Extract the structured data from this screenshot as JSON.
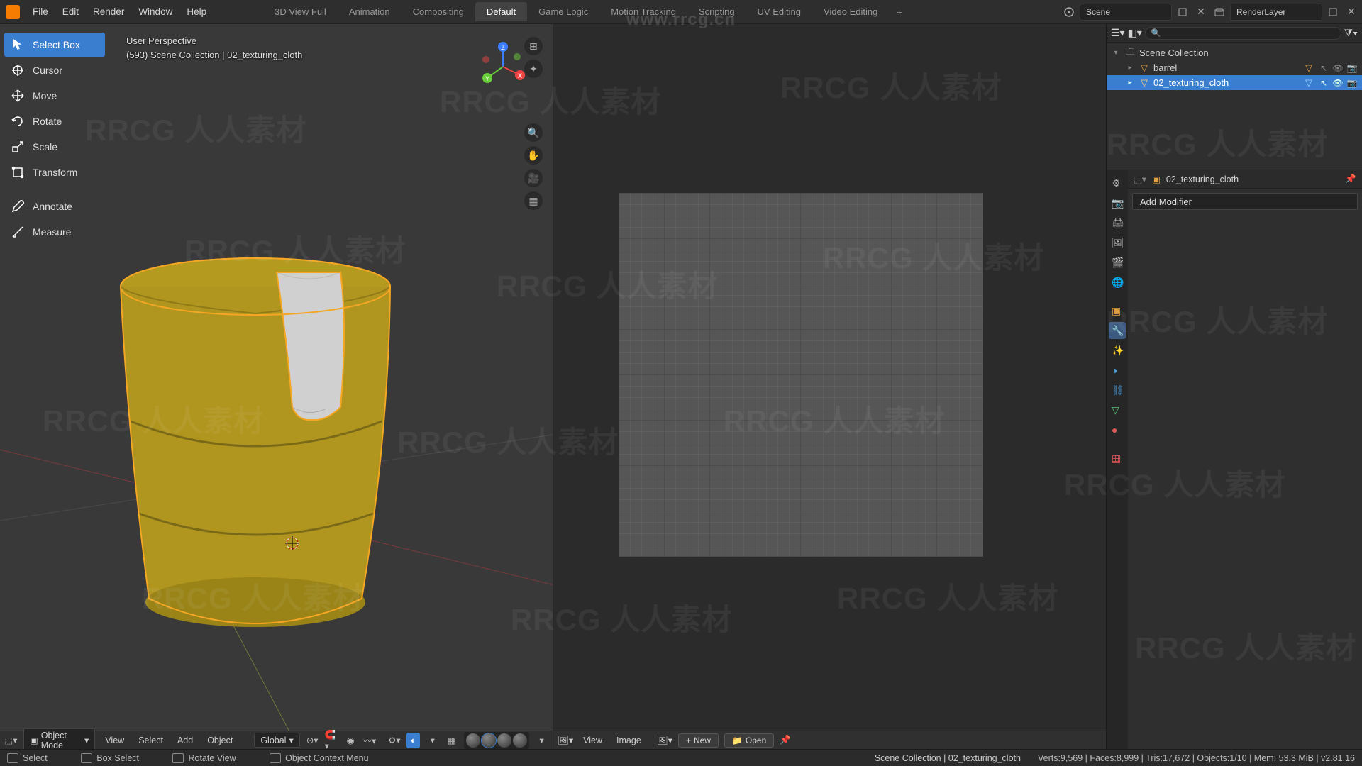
{
  "menubar": {
    "items": [
      "File",
      "Edit",
      "Render",
      "Window",
      "Help"
    ]
  },
  "workspaces": {
    "tabs": [
      "3D View Full",
      "Animation",
      "Compositing",
      "Default",
      "Game Logic",
      "Motion Tracking",
      "Scripting",
      "UV Editing",
      "Video Editing"
    ],
    "active": "Default"
  },
  "top_right": {
    "scene_label": "Scene",
    "layer_label": "RenderLayer"
  },
  "viewport": {
    "overlay_line1": "User Perspective",
    "overlay_line2": "(593) Scene Collection | 02_texturing_cloth",
    "tools": [
      {
        "name": "select-box",
        "label": "Select Box",
        "active": true
      },
      {
        "name": "cursor",
        "label": "Cursor"
      },
      {
        "name": "move",
        "label": "Move"
      },
      {
        "name": "rotate",
        "label": "Rotate"
      },
      {
        "name": "scale",
        "label": "Scale"
      },
      {
        "name": "transform",
        "label": "Transform"
      },
      {
        "name": "annotate",
        "label": "Annotate"
      },
      {
        "name": "measure",
        "label": "Measure"
      }
    ],
    "header": {
      "mode": "Object Mode",
      "menus": [
        "View",
        "Select",
        "Add",
        "Object"
      ],
      "orientation": "Global"
    }
  },
  "image_editor": {
    "menus": [
      "View",
      "Image"
    ],
    "new_label": "New",
    "open_label": "Open"
  },
  "outliner": {
    "search_placeholder": "",
    "root": "Scene Collection",
    "items": [
      {
        "name": "barrel",
        "selected": false,
        "icon": "mesh"
      },
      {
        "name": "02_texturing_cloth",
        "selected": true,
        "icon": "mesh"
      }
    ]
  },
  "properties": {
    "crumb_obj": "02_texturing_cloth",
    "add_modifier_label": "Add Modifier",
    "tabs": [
      {
        "name": "settings",
        "color": "#aaa"
      },
      {
        "name": "render",
        "color": "#aaa"
      },
      {
        "name": "output",
        "color": "#aaa"
      },
      {
        "name": "viewlayer",
        "color": "#aaa"
      },
      {
        "name": "scene",
        "color": "#aaa"
      },
      {
        "name": "world",
        "color": "#d04444"
      },
      {
        "name": "object",
        "color": "#e09a3a"
      },
      {
        "name": "modifier",
        "color": "#4e8fe0",
        "active": true
      },
      {
        "name": "particle",
        "color": "#4ea0e0"
      },
      {
        "name": "physics",
        "color": "#4ea0e0"
      },
      {
        "name": "constraint",
        "color": "#4ea0e0"
      },
      {
        "name": "mesh",
        "color": "#55c070"
      },
      {
        "name": "material",
        "color": "#e05a5a"
      },
      {
        "name": "texture",
        "color": "#e05a5a"
      }
    ]
  },
  "statusbar": {
    "hints": [
      {
        "icon": "lmb",
        "text": "Select"
      },
      {
        "icon": "lmb",
        "text": "Box Select"
      },
      {
        "icon": "mmb",
        "text": "Rotate View"
      },
      {
        "icon": "rmb",
        "text": "Object Context Menu"
      }
    ],
    "crumb": "Scene Collection | 02_texturing_cloth",
    "stats": "Verts:9,569 | Faces:8,999 | Tris:17,672 | Objects:1/10 | Mem: 53.3 MiB | v2.81.16"
  },
  "watermark": {
    "url": "www.rrcg.cn",
    "text_en": "RRCG",
    "text_cn": "人人素材"
  }
}
